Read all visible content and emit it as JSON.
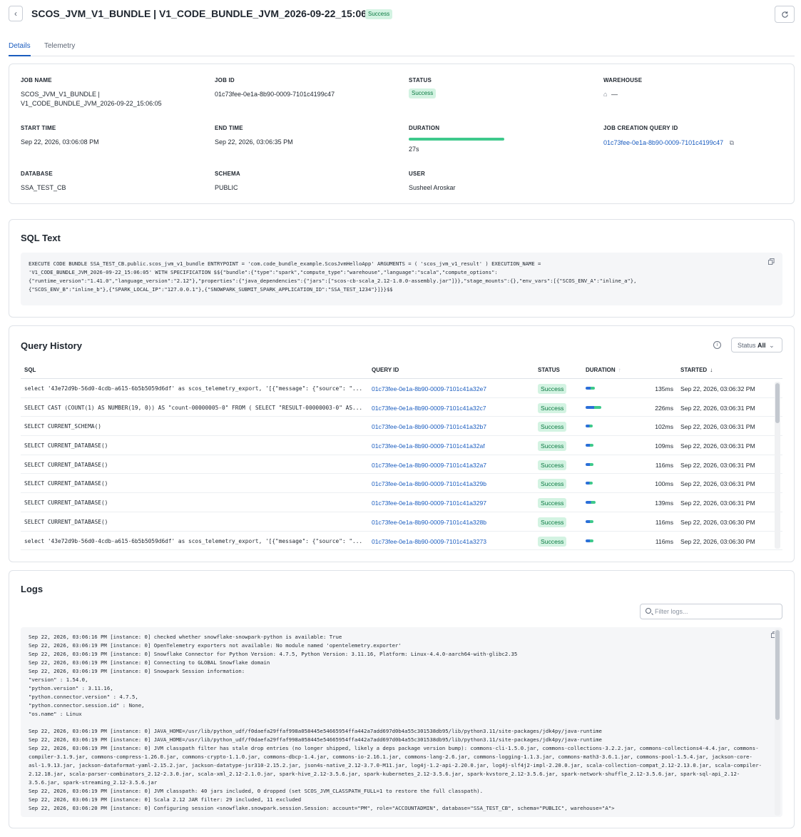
{
  "header": {
    "back_icon": "chevron-left-icon",
    "title": "SCOS_JVM_V1_BUNDLE | V1_CODE_BUNDLE_JVM_2026-09-22_15:06:05",
    "status": "Success",
    "refresh_icon": "refresh-icon"
  },
  "tabs": [
    {
      "label": "Details",
      "active": true
    },
    {
      "label": "Telemetry",
      "active": false
    }
  ],
  "details": {
    "job_name_label": "JOB NAME",
    "job_name_line1": "SCOS_JVM_V1_BUNDLE |",
    "job_name_line2": "V1_CODE_BUNDLE_JVM_2026-09-22_15:06:05",
    "job_id_label": "JOB ID",
    "job_id": "01c73fee-0e1a-8b90-0009-7101c4199c47",
    "status_label": "STATUS",
    "status": "Success",
    "warehouse_label": "WAREHOUSE",
    "warehouse_value": "—",
    "start_time_label": "START TIME",
    "start_time": "Sep 22, 2026, 03:06:08 PM",
    "end_time_label": "END TIME",
    "end_time": "Sep 22, 2026, 03:06:35 PM",
    "duration_label": "DURATION",
    "duration": "27s",
    "duration_fill": 1.0,
    "job_creation_query_id_label": "JOB CREATION QUERY ID",
    "job_creation_query_id": "01c73fee-0e1a-8b90-0009-7101c4199c47",
    "database_label": "DATABASE",
    "database": "SSA_TEST_CB",
    "schema_label": "SCHEMA",
    "schema": "PUBLIC",
    "user_label": "USER",
    "user": "Susheel Aroskar"
  },
  "sql_text": {
    "title": "SQL Text",
    "lines": [
      "EXECUTE CODE BUNDLE SSA_TEST_CB.public.scos_jvm_v1_bundle ENTRYPOINT = 'com.code_bundle_example.ScosJvmHelloApp'    ARGUMENTS = (                'scos_jvm_v1_result'          )     EXECUTION_NAME =",
      "'V1_CODE_BUNDLE_JVM_2026-09-22_15:06:05'     WITH SPECIFICATION $${\"bundle\":{\"type\":\"spark\",\"compute_type\":\"warehouse\",\"language\":\"scala\",\"compute_options\":",
      "{\"runtime_version\":\"1.41.0\",\"language_version\":\"2.12\"},\"properties\":{\"java_dependencies\":{\"jars\":[\"scos-cb-scala_2.12-1.0.0-assembly.jar\"]}},\"stage_mounts\":{},\"env_vars\":[{\"SCOS_ENV_A\":\"inline_a\"},",
      "{\"SCOS_ENV_B\":\"inline_b\"},{\"SPARK_LOCAL_IP\":\"127.0.0.1\"},{\"SNOWPARK_SUBMIT_SPARK_APPLICATION_ID\":\"SSA_TEST_1234\"}]}}$$"
    ]
  },
  "query_history": {
    "title": "Query History",
    "status_filter_label": "Status",
    "status_filter_value": "All",
    "columns": [
      "SQL",
      "QUERY ID",
      "STATUS",
      "DURATION",
      "STARTED"
    ],
    "rows": [
      {
        "sql": "select '43e72d9b-56d0-4cdb-a615-6b5b5059d6df' as scos_telemetry_export, '[{\"message\": {\"source\": \"...",
        "query_id": "01c73fee-0e1a-8b90-0009-7101c41a32e7",
        "status": "Success",
        "duration": "135ms",
        "duration_ms": 135,
        "started": "Sep 22, 2026, 03:06:32 PM"
      },
      {
        "sql": "SELECT CAST (COUNT(1) AS NUMBER(19, 0)) AS \"count-00000005-0\" FROM ( SELECT \"RESULT-00000003-0\" AS...",
        "query_id": "01c73fee-0e1a-8b90-0009-7101c41a32c7",
        "status": "Success",
        "duration": "226ms",
        "duration_ms": 226,
        "started": "Sep 22, 2026, 03:06:31 PM"
      },
      {
        "sql": "SELECT CURRENT_SCHEMA()",
        "query_id": "01c73fee-0e1a-8b90-0009-7101c41a32b7",
        "status": "Success",
        "duration": "102ms",
        "duration_ms": 102,
        "started": "Sep 22, 2026, 03:06:31 PM"
      },
      {
        "sql": "SELECT CURRENT_DATABASE()",
        "query_id": "01c73fee-0e1a-8b90-0009-7101c41a32af",
        "status": "Success",
        "duration": "109ms",
        "duration_ms": 109,
        "started": "Sep 22, 2026, 03:06:31 PM"
      },
      {
        "sql": "SELECT CURRENT_DATABASE()",
        "query_id": "01c73fee-0e1a-8b90-0009-7101c41a32a7",
        "status": "Success",
        "duration": "116ms",
        "duration_ms": 116,
        "started": "Sep 22, 2026, 03:06:31 PM"
      },
      {
        "sql": "SELECT CURRENT_DATABASE()",
        "query_id": "01c73fee-0e1a-8b90-0009-7101c41a329b",
        "status": "Success",
        "duration": "100ms",
        "duration_ms": 100,
        "started": "Sep 22, 2026, 03:06:31 PM"
      },
      {
        "sql": "SELECT CURRENT_DATABASE()",
        "query_id": "01c73fee-0e1a-8b90-0009-7101c41a3297",
        "status": "Success",
        "duration": "139ms",
        "duration_ms": 139,
        "started": "Sep 22, 2026, 03:06:31 PM"
      },
      {
        "sql": "SELECT CURRENT_DATABASE()",
        "query_id": "01c73fee-0e1a-8b90-0009-7101c41a328b",
        "status": "Success",
        "duration": "116ms",
        "duration_ms": 116,
        "started": "Sep 22, 2026, 03:06:30 PM"
      },
      {
        "sql": "select '43e72d9b-56d0-4cdb-a615-6b5b5059d6df' as scos_telemetry_export, '[{\"message\": {\"source\": \"...",
        "query_id": "01c73fee-0e1a-8b90-0009-7101c41a3273",
        "status": "Success",
        "duration": "116ms",
        "duration_ms": 116,
        "started": "Sep 22, 2026, 03:06:30 PM"
      }
    ]
  },
  "logs": {
    "title": "Logs",
    "filter_placeholder": "Filter logs...",
    "lines": [
      "Sep 22, 2026, 03:06:16 PM [instance: 0] checked whether snowflake-snowpark-python is available: True",
      "Sep 22, 2026, 03:06:19 PM [instance: 0] OpenTelemetry exporters not available: No module named 'opentelemetry.exporter'",
      "Sep 22, 2026, 03:06:19 PM [instance: 0] Snowflake Connector for Python Version: 4.7.5, Python Version: 3.11.16, Platform: Linux-4.4.0-aarch64-with-glibc2.35",
      "Sep 22, 2026, 03:06:19 PM [instance: 0] Connecting to GLOBAL Snowflake domain",
      "Sep 22, 2026, 03:06:19 PM [instance: 0] Snowpark Session information:",
      "\"version\" : 1.54.0,",
      "\"python.version\" : 3.11.16,",
      "\"python.connector.version\" : 4.7.5,",
      "\"python.connector.session.id\" : None,",
      "\"os.name\" : Linux",
      "",
      "Sep 22, 2026, 03:06:19 PM [instance: 0] JAVA_HOME=/usr/lib/python_udf/f0daefa29ffaf998a058445e54665954ffa442a7add697d0b4a55c301538db95/lib/python3.11/site-packages/jdk4py/java-runtime",
      "Sep 22, 2026, 03:06:19 PM [instance: 0] JAVA_HOME=/usr/lib/python_udf/f0daefa29ffaf998a058445e54665954ffa442a7add697d0b4a55c301538db95/lib/python3.11/site-packages/jdk4py/java-runtime",
      "Sep 22, 2026, 03:06:19 PM [instance: 0] JVM classpath filter has stale drop entries (no longer shipped, likely a deps package version bump): commons-cli-1.5.0.jar, commons-collections-3.2.2.jar, commons-collections4-4.4.jar, commons-compiler-3.1.9.jar, commons-compress-1.26.0.jar, commons-crypto-1.1.0.jar, commons-dbcp-1.4.jar, commons-io-2.16.1.jar, commons-lang-2.6.jar, commons-logging-1.1.3.jar, commons-math3-3.6.1.jar, commons-pool-1.5.4.jar, jackson-core-asl-1.9.13.jar, jackson-dataformat-yaml-2.15.2.jar, jackson-datatype-jsr310-2.15.2.jar, json4s-native_2.12-3.7.0-M11.jar, log4j-1.2-api-2.20.0.jar, log4j-slf4j2-impl-2.20.0.jar, scala-collection-compat_2.12-2.13.0.jar, scala-compiler-2.12.18.jar, scala-parser-combinators_2.12-2.3.0.jar, scala-xml_2.12-2.1.0.jar, spark-hive_2.12-3.5.6.jar, spark-kubernetes_2.12-3.5.6.jar, spark-kvstore_2.12-3.5.6.jar, spark-network-shuffle_2.12-3.5.6.jar, spark-sql-api_2.12-3.5.6.jar, spark-streaming_2.12-3.5.6.jar",
      "Sep 22, 2026, 03:06:19 PM [instance: 0] JVM classpath: 40 jars included, 0 dropped (set SCOS_JVM_CLASSPATH_FULL=1 to restore the full classpath).",
      "Sep 22, 2026, 03:06:19 PM [instance: 0] Scala 2.12 JAR filter: 29 included, 11 excluded",
      "Sep 22, 2026, 03:06:20 PM [instance: 0] Configuring session <snowflake.snowpark.session.Session: account=\"PM\", role=\"ACCOUNTADMIN\", database=\"SSA_TEST_CB\", schema=\"PUBLIC\", warehouse=\"A\">"
    ]
  },
  "colors": {
    "accent": "#1a5cbf",
    "success_bg": "#d3f3e2",
    "success_text": "#0c7a43",
    "duration_bar": "#3ec98c",
    "duration_blue": "#2b6fd8"
  }
}
